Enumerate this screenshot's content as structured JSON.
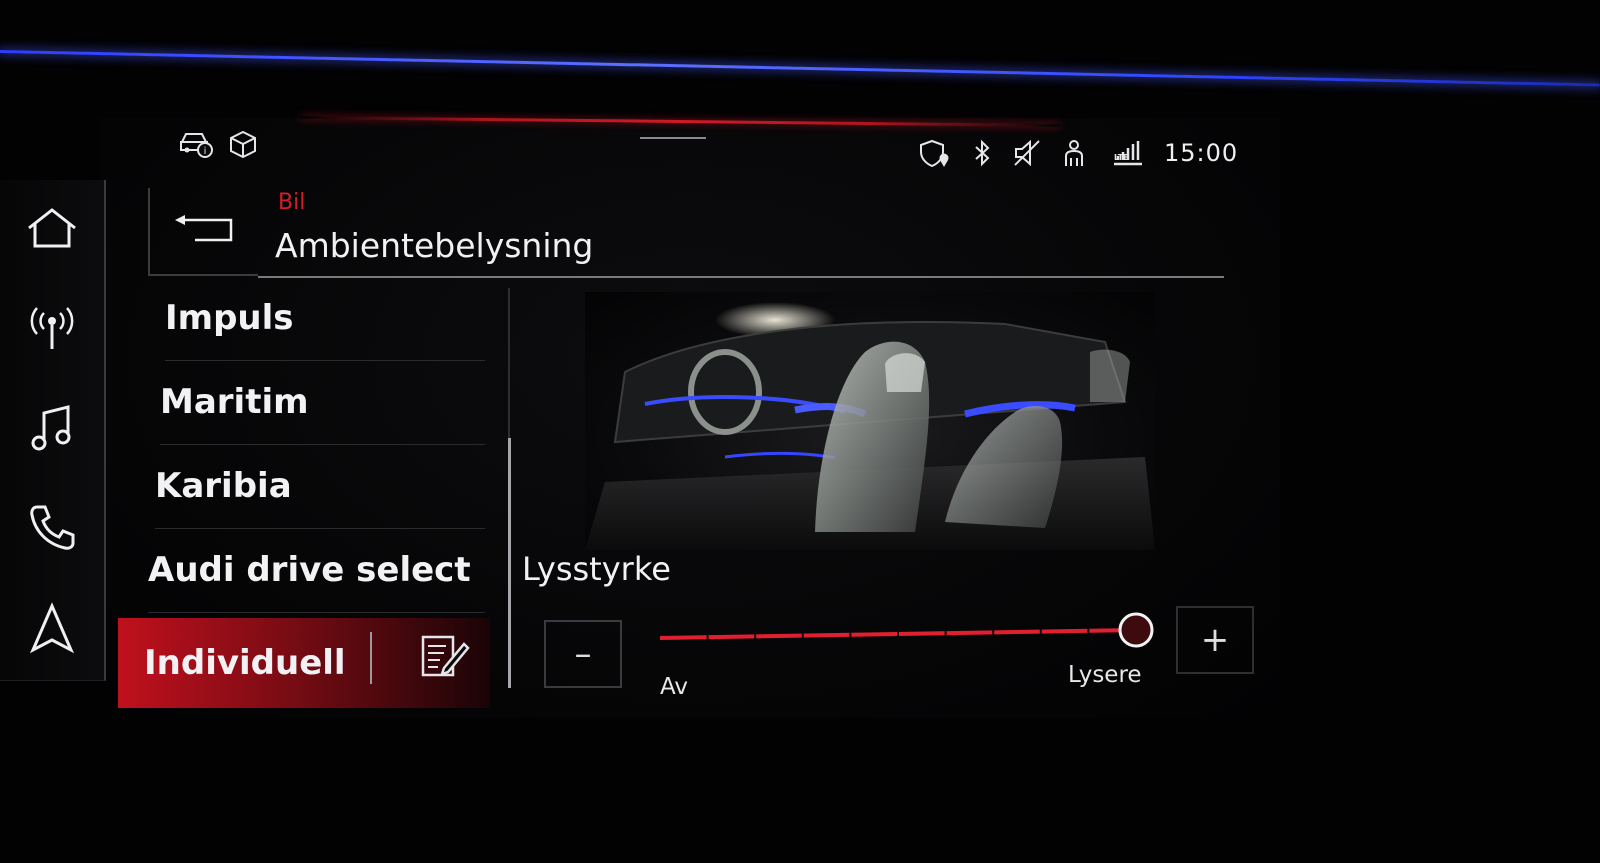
{
  "status_bar": {
    "clock": "15:00",
    "left_icons": [
      "car-info-icon",
      "box-3d-icon"
    ],
    "right_icons": [
      "shield-location-icon",
      "bluetooth-icon",
      "speaker-muted-icon",
      "person-signal-icon",
      "lte-signal-icon"
    ]
  },
  "sidebar": {
    "items": [
      {
        "icon": "home-icon"
      },
      {
        "icon": "radio-icon"
      },
      {
        "icon": "music-note-icon"
      },
      {
        "icon": "phone-icon"
      },
      {
        "icon": "navigation-icon"
      }
    ]
  },
  "header": {
    "breadcrumb": "Bil",
    "title": "Ambientebelysning",
    "back_icon": "back-arrow-icon"
  },
  "menu": {
    "items": [
      {
        "label": "Impuls"
      },
      {
        "label": "Maritim"
      },
      {
        "label": "Karibia"
      },
      {
        "label": "Audi drive select"
      },
      {
        "label": "Individuell",
        "selected": true
      }
    ],
    "edit_icon": "edit-icon"
  },
  "brightness": {
    "label": "Lysstyrke",
    "decrease_label": "–",
    "increase_label": "+",
    "min_label": "Av",
    "max_label": "Lysere",
    "value_fraction": 1.0
  },
  "colors": {
    "accent_red": "#d01a27",
    "ambient_blue": "#3a4cff",
    "text": "#f2f2f5"
  }
}
